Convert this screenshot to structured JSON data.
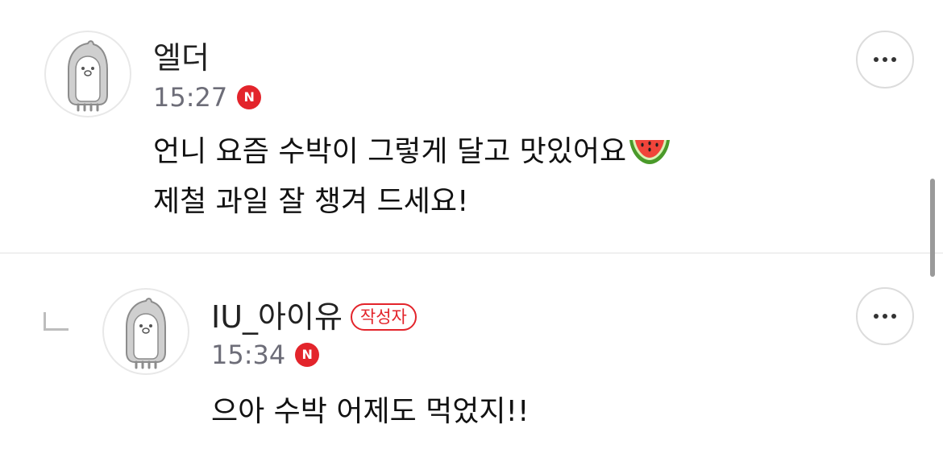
{
  "comments": [
    {
      "author": "엘더",
      "time": "15:27",
      "new_badge": "N",
      "lines": [
        "언니 요즘 수박이 그렇게 달고 맛있어요",
        "제철 과일 잘 챙겨 드세요!"
      ],
      "emoji": "watermelon-icon",
      "more_label": "..."
    },
    {
      "author": "IU_아이유",
      "author_badge": "작성자",
      "time": "15:34",
      "new_badge": "N",
      "lines": [
        "으아 수박 어제도 먹었지!!"
      ],
      "more_label": "..."
    }
  ],
  "colors": {
    "accent_red": "#e3242b",
    "time_gray": "#6d6d78",
    "divider": "#e2e2e2"
  }
}
